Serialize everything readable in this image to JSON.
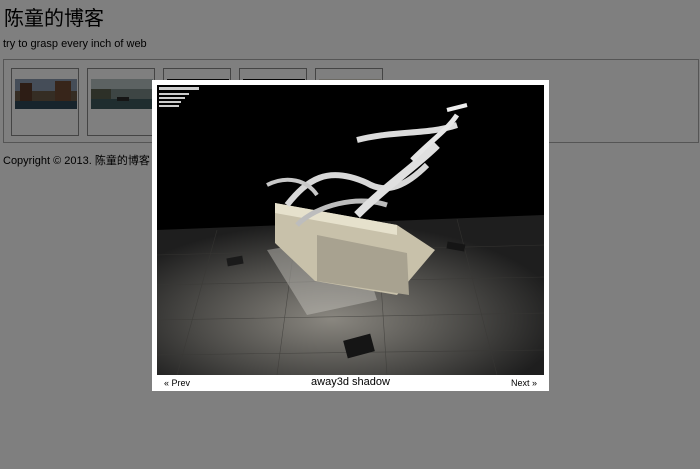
{
  "site": {
    "title": "陈童的博客",
    "tagline": "try to grasp every inch of web",
    "copyright": "Copyright © 2013. 陈童的博客"
  },
  "gallery": {
    "thumbnails": [
      {
        "name": "venice-canal"
      },
      {
        "name": "canal-boat"
      },
      {
        "name": "dark-scene-1"
      },
      {
        "name": "dark-scene-2"
      },
      {
        "name": "bright-scene"
      }
    ]
  },
  "lightbox": {
    "prev_label": "« Prev",
    "next_label": "Next »",
    "caption": "away3d shadow"
  }
}
